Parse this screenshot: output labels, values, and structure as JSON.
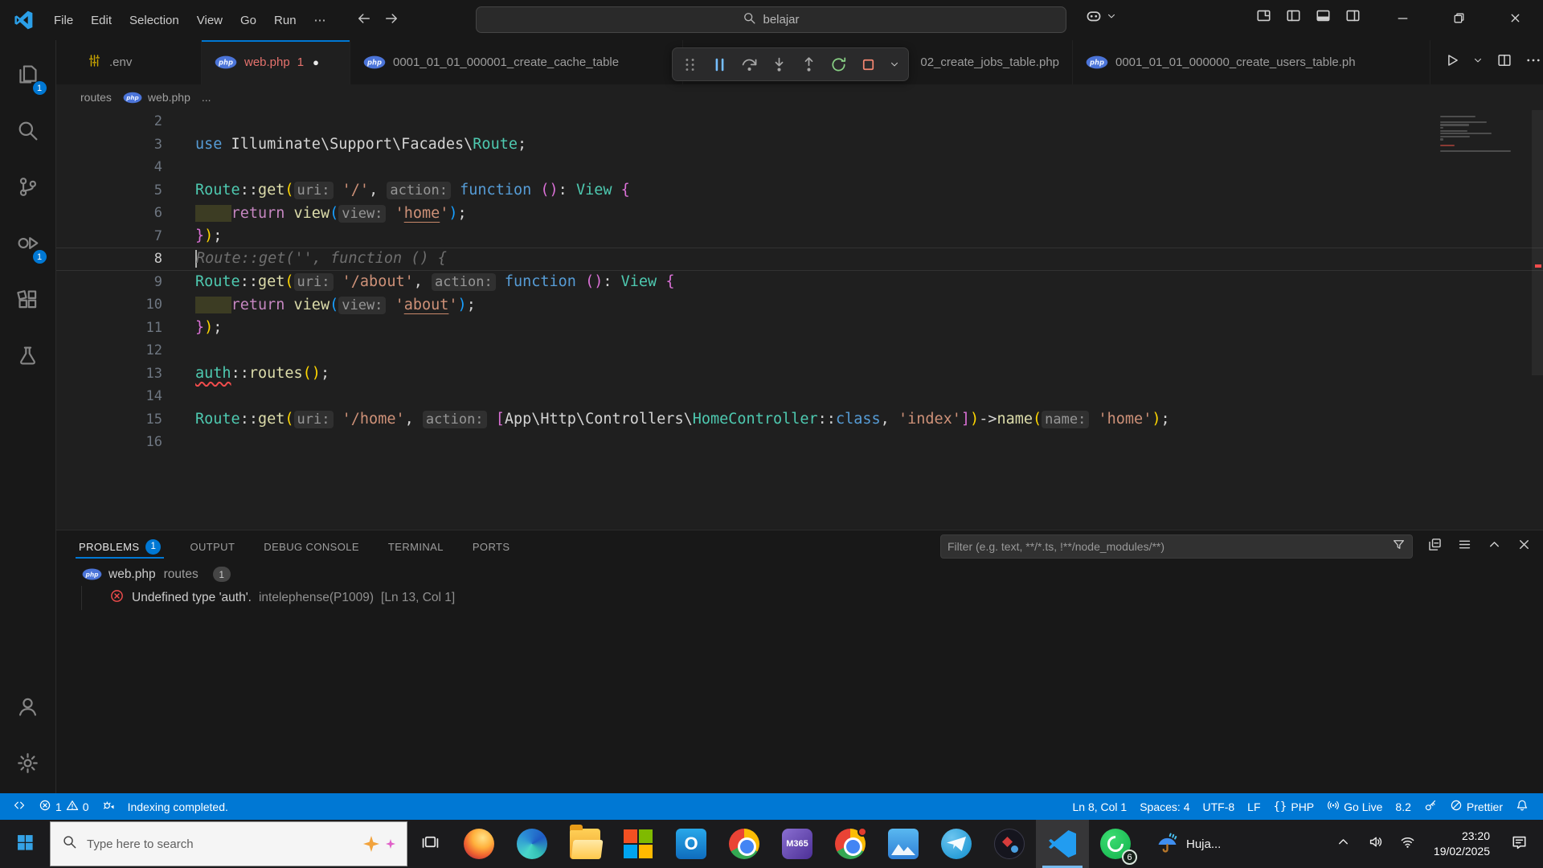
{
  "colors": {
    "accent": "#0078d4",
    "statusbar": "#0078d4",
    "error": "#f14c4c",
    "tab_error": "#e5726d"
  },
  "titlebar": {
    "menus": [
      "File",
      "Edit",
      "Selection",
      "View",
      "Go",
      "Run"
    ],
    "more_label": "⋯",
    "search_value": "belajar"
  },
  "activity_bar": {
    "explorer_badge": "1",
    "debug_badge": "1"
  },
  "tab_bar": {
    "tabs": [
      {
        "key": "env",
        "icon": "sliders",
        "label": ".env"
      },
      {
        "key": "web-php",
        "icon": "php",
        "label": "web.php",
        "error_count": "1",
        "modified": true,
        "active": true
      },
      {
        "key": "create-cache-table",
        "icon": "php",
        "label": "0001_01_01_000001_create_cache_table"
      },
      {
        "key": "create-jobs-table",
        "icon": "none",
        "label": "02_create_jobs_table.php"
      },
      {
        "key": "create-users-table",
        "icon": "php",
        "label": "0001_01_01_000000_create_users_table.ph"
      }
    ]
  },
  "breadcrumb": {
    "folder": "routes",
    "file": "web.php",
    "more": "..."
  },
  "debug_toolbar": [
    "drag-grip",
    "pause",
    "step-over",
    "step-into",
    "step-out",
    "restart",
    "stop",
    "chevron-down"
  ],
  "editor": {
    "cursor_line": 8,
    "lines": [
      {
        "n": 2,
        "t": []
      },
      {
        "n": 3,
        "t": [
          [
            "kw",
            "use"
          ],
          [
            "txt",
            " Illuminate\\Support\\Facades\\"
          ],
          [
            "cls",
            "Route"
          ],
          [
            "txt",
            ";"
          ]
        ]
      },
      {
        "n": 4,
        "t": []
      },
      {
        "n": 5,
        "t": [
          [
            "cls",
            "Route"
          ],
          [
            "txt",
            "::"
          ],
          [
            "fn",
            "get"
          ],
          [
            "b1",
            "("
          ],
          [
            "hint",
            "uri:"
          ],
          [
            "txt",
            " "
          ],
          [
            "str",
            "'/'"
          ],
          [
            "txt",
            ", "
          ],
          [
            "hint",
            "action:"
          ],
          [
            "txt",
            " "
          ],
          [
            "kw",
            "function"
          ],
          [
            "txt",
            " "
          ],
          [
            "b2",
            "()"
          ],
          [
            "txt",
            ": "
          ],
          [
            "cls",
            "View"
          ],
          [
            "txt",
            " "
          ],
          [
            "b2",
            "{"
          ]
        ]
      },
      {
        "n": 6,
        "t": [
          [
            "indent",
            "    "
          ],
          [
            "ret",
            "return"
          ],
          [
            "txt",
            " "
          ],
          [
            "fn",
            "view"
          ],
          [
            "b3",
            "("
          ],
          [
            "hint",
            "view:"
          ],
          [
            "txt",
            " "
          ],
          [
            "str",
            "'"
          ],
          [
            "link",
            "home"
          ],
          [
            "str",
            "'"
          ],
          [
            "b3",
            ")"
          ],
          [
            "txt",
            ";"
          ]
        ]
      },
      {
        "n": 7,
        "t": [
          [
            "b2",
            "}"
          ],
          [
            "b1",
            ")"
          ],
          [
            "txt",
            ";"
          ]
        ]
      },
      {
        "n": 8,
        "t": [
          [
            "ghost",
            "Route::get('', function () {"
          ]
        ]
      },
      {
        "n": 9,
        "t": [
          [
            "cls",
            "Route"
          ],
          [
            "txt",
            "::"
          ],
          [
            "fn",
            "get"
          ],
          [
            "b1",
            "("
          ],
          [
            "hint",
            "uri:"
          ],
          [
            "txt",
            " "
          ],
          [
            "str",
            "'/about'"
          ],
          [
            "txt",
            ", "
          ],
          [
            "hint",
            "action:"
          ],
          [
            "txt",
            " "
          ],
          [
            "kw",
            "function"
          ],
          [
            "txt",
            " "
          ],
          [
            "b2",
            "()"
          ],
          [
            "txt",
            ": "
          ],
          [
            "cls",
            "View"
          ],
          [
            "txt",
            " "
          ],
          [
            "b2",
            "{"
          ]
        ]
      },
      {
        "n": 10,
        "t": [
          [
            "indent",
            "    "
          ],
          [
            "ret",
            "return"
          ],
          [
            "txt",
            " "
          ],
          [
            "fn",
            "view"
          ],
          [
            "b3",
            "("
          ],
          [
            "hint",
            "view:"
          ],
          [
            "txt",
            " "
          ],
          [
            "str",
            "'"
          ],
          [
            "link",
            "about"
          ],
          [
            "str",
            "'"
          ],
          [
            "b3",
            ")"
          ],
          [
            "txt",
            ";"
          ]
        ]
      },
      {
        "n": 11,
        "t": [
          [
            "b2",
            "}"
          ],
          [
            "b1",
            ")"
          ],
          [
            "txt",
            ";"
          ]
        ]
      },
      {
        "n": 12,
        "t": []
      },
      {
        "n": 13,
        "t": [
          [
            "err",
            "auth"
          ],
          [
            "txt",
            "::"
          ],
          [
            "fn",
            "routes"
          ],
          [
            "b1",
            "()"
          ],
          [
            "txt",
            ";"
          ]
        ]
      },
      {
        "n": 14,
        "t": []
      },
      {
        "n": 15,
        "t": [
          [
            "cls",
            "Route"
          ],
          [
            "txt",
            "::"
          ],
          [
            "fn",
            "get"
          ],
          [
            "b1",
            "("
          ],
          [
            "hint",
            "uri:"
          ],
          [
            "txt",
            " "
          ],
          [
            "str",
            "'/home'"
          ],
          [
            "txt",
            ", "
          ],
          [
            "hint",
            "action:"
          ],
          [
            "txt",
            " "
          ],
          [
            "b2",
            "["
          ],
          [
            "txt",
            "App\\Http\\Controllers\\"
          ],
          [
            "cls",
            "HomeController"
          ],
          [
            "txt",
            "::"
          ],
          [
            "kw",
            "class"
          ],
          [
            "txt",
            ", "
          ],
          [
            "str",
            "'index'"
          ],
          [
            "b2",
            "]"
          ],
          [
            "b1",
            ")"
          ],
          [
            "txt",
            "->"
          ],
          [
            "fn",
            "name"
          ],
          [
            "b1",
            "("
          ],
          [
            "hint",
            "name:"
          ],
          [
            "txt",
            " "
          ],
          [
            "str",
            "'home'"
          ],
          [
            "b1",
            ")"
          ],
          [
            "txt",
            ";"
          ]
        ]
      },
      {
        "n": 16,
        "t": []
      }
    ]
  },
  "panel": {
    "tabs": [
      {
        "key": "problems",
        "label": "PROBLEMS",
        "badge": "1",
        "active": true
      },
      {
        "key": "output",
        "label": "OUTPUT"
      },
      {
        "key": "debug-console",
        "label": "DEBUG CONSOLE"
      },
      {
        "key": "terminal",
        "label": "TERMINAL"
      },
      {
        "key": "ports",
        "label": "PORTS"
      }
    ],
    "filter_placeholder": "Filter (e.g. text, **/*.ts, !**/node_modules/**)",
    "group": {
      "file": "web.php",
      "folder": "routes",
      "count": "1"
    },
    "problems": [
      {
        "severity": "error",
        "message": "Undefined type 'auth'.",
        "source": "intelephense(P1009)",
        "location": "[Ln 13, Col 1]"
      }
    ]
  },
  "status_bar": {
    "errors": "1",
    "warnings": "0",
    "message": "Indexing completed.",
    "right": [
      {
        "key": "cursor-position",
        "label": "Ln 8, Col 1"
      },
      {
        "key": "indentation",
        "label": "Spaces: 4"
      },
      {
        "key": "encoding",
        "label": "UTF-8"
      },
      {
        "key": "eol",
        "label": "LF"
      },
      {
        "key": "language",
        "icon": "braces",
        "label": "PHP"
      },
      {
        "key": "go-live",
        "icon": "broadcast",
        "label": "Go Live"
      },
      {
        "key": "php-version",
        "label": "8.2"
      },
      {
        "key": "key",
        "icon": "key",
        "label": ""
      },
      {
        "key": "prettier",
        "icon": "circle-slash",
        "label": "Prettier"
      },
      {
        "key": "notifications",
        "icon": "bell",
        "label": ""
      }
    ]
  },
  "taskbar": {
    "search_placeholder": "Type here to search",
    "apps": [
      "firefox",
      "edge",
      "file-explorer",
      "microsoft-store",
      "outlook",
      "chrome",
      "m365-copilot",
      "chrome-2",
      "photos",
      "telegram",
      "obs",
      "vscode",
      "whatsapp"
    ],
    "active_app": "vscode",
    "m365_label": "M365",
    "outlook_letter": "O",
    "whatsapp_badge": "6",
    "weather_label": "Huja...",
    "time": "23:20",
    "date": "19/02/2025"
  }
}
